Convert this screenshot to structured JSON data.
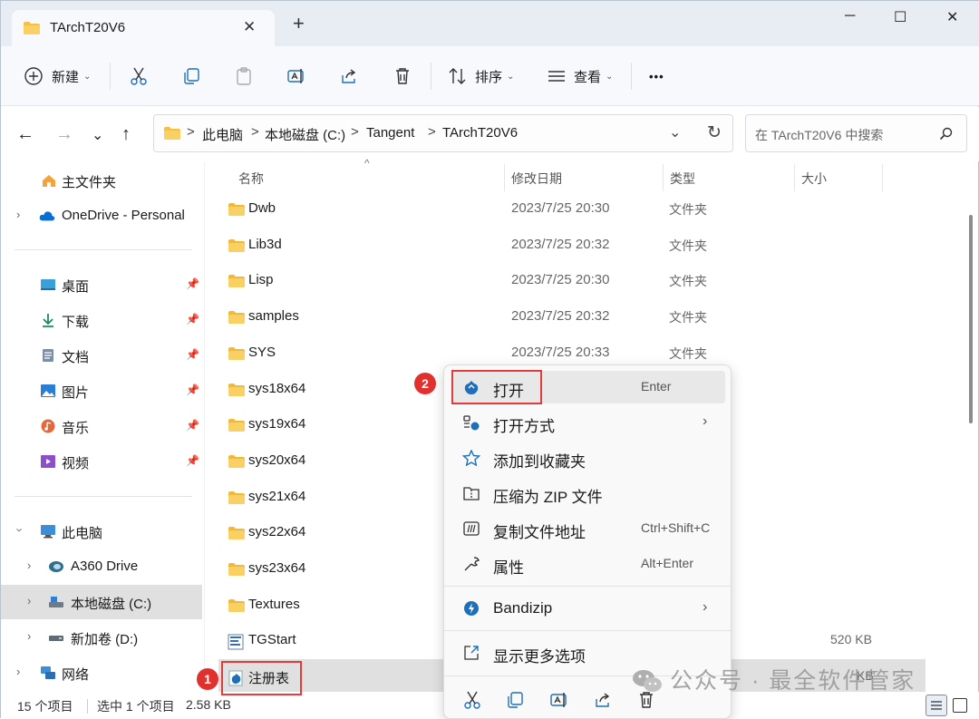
{
  "window": {
    "tab_title": "TArchT20V6",
    "new_tab_symbol": "+",
    "close_tab_symbol": "✕",
    "minimize_symbol": "─",
    "maximize_symbol": "☐",
    "close_symbol": "✕"
  },
  "toolbar": {
    "new_label": "新建",
    "sort_label": "排序",
    "view_label": "查看",
    "more_symbol": "•••"
  },
  "address": {
    "crumbs": [
      "此电脑",
      "本地磁盘 (C:)",
      "Tangent",
      "TArchT20V6"
    ],
    "separator": ">",
    "search_placeholder": "在 TArchT20V6 中搜索"
  },
  "sidebar": {
    "items": [
      {
        "label": "主文件夹",
        "icon": "home-icon"
      },
      {
        "label": "OneDrive - Personal",
        "icon": "cloud-icon"
      },
      {
        "label": "桌面",
        "icon": "desktop-icon"
      },
      {
        "label": "下载",
        "icon": "download-icon"
      },
      {
        "label": "文档",
        "icon": "document-icon"
      },
      {
        "label": "图片",
        "icon": "pictures-icon"
      },
      {
        "label": "音乐",
        "icon": "music-icon"
      },
      {
        "label": "视频",
        "icon": "video-icon"
      },
      {
        "label": "此电脑",
        "icon": "computer-icon"
      },
      {
        "label": "A360 Drive",
        "icon": "a360-icon"
      },
      {
        "label": "本地磁盘 (C:)",
        "icon": "drive-icon"
      },
      {
        "label": "新加卷 (D:)",
        "icon": "drive-icon"
      },
      {
        "label": "网络",
        "icon": "network-icon"
      }
    ]
  },
  "columns": {
    "name": "名称",
    "date": "修改日期",
    "type": "类型",
    "size": "大小"
  },
  "files": [
    {
      "name": "Dwb",
      "date": "2023/7/25 20:30",
      "type": "文件夹",
      "size": ""
    },
    {
      "name": "Lib3d",
      "date": "2023/7/25 20:32",
      "type": "文件夹",
      "size": ""
    },
    {
      "name": "Lisp",
      "date": "2023/7/25 20:30",
      "type": "文件夹",
      "size": ""
    },
    {
      "name": "samples",
      "date": "2023/7/25 20:32",
      "type": "文件夹",
      "size": ""
    },
    {
      "name": "SYS",
      "date": "2023/7/25 20:33",
      "type": "文件夹",
      "size": ""
    },
    {
      "name": "sys18x64",
      "date": "",
      "type": "",
      "size": ""
    },
    {
      "name": "sys19x64",
      "date": "",
      "type": "",
      "size": ""
    },
    {
      "name": "sys20x64",
      "date": "",
      "type": "",
      "size": ""
    },
    {
      "name": "sys21x64",
      "date": "",
      "type": "",
      "size": ""
    },
    {
      "name": "sys22x64",
      "date": "",
      "type": "",
      "size": ""
    },
    {
      "name": "sys23x64",
      "date": "",
      "type": "",
      "size": ""
    },
    {
      "name": "Textures",
      "date": "",
      "type": "",
      "size": ""
    },
    {
      "name": "TGStart",
      "date": "",
      "type": "",
      "size": "520 KB"
    },
    {
      "name": "注册表",
      "date": "",
      "type": "",
      "size": "KB"
    }
  ],
  "context_menu": {
    "items": [
      {
        "label": "打开",
        "shortcut": "Enter",
        "icon": "open-app-icon"
      },
      {
        "label": "打开方式",
        "shortcut": "",
        "icon": "open-with-icon",
        "arrow": "›"
      },
      {
        "label": "添加到收藏夹",
        "shortcut": "",
        "icon": "star-icon"
      },
      {
        "label": "压缩为 ZIP 文件",
        "shortcut": "",
        "icon": "zip-icon"
      },
      {
        "label": "复制文件地址",
        "shortcut": "Ctrl+Shift+C",
        "icon": "copy-path-icon"
      },
      {
        "label": "属性",
        "shortcut": "Alt+Enter",
        "icon": "wrench-icon"
      },
      {
        "label": "Bandizip",
        "shortcut": "",
        "icon": "bandizip-icon",
        "arrow": "›"
      },
      {
        "label": "显示更多选项",
        "shortcut": "",
        "icon": "more-options-icon"
      }
    ]
  },
  "status": {
    "count": "15 个项目",
    "selected": "选中 1 个项目",
    "size": "2.58 KB"
  },
  "annotations": {
    "badge1": "1",
    "badge2": "2"
  },
  "watermark": "公众号 · 最全软件管家",
  "colors": {
    "accent": "#0067c0",
    "folder": "#f4c144",
    "annotation_red": "#e23b3b"
  }
}
